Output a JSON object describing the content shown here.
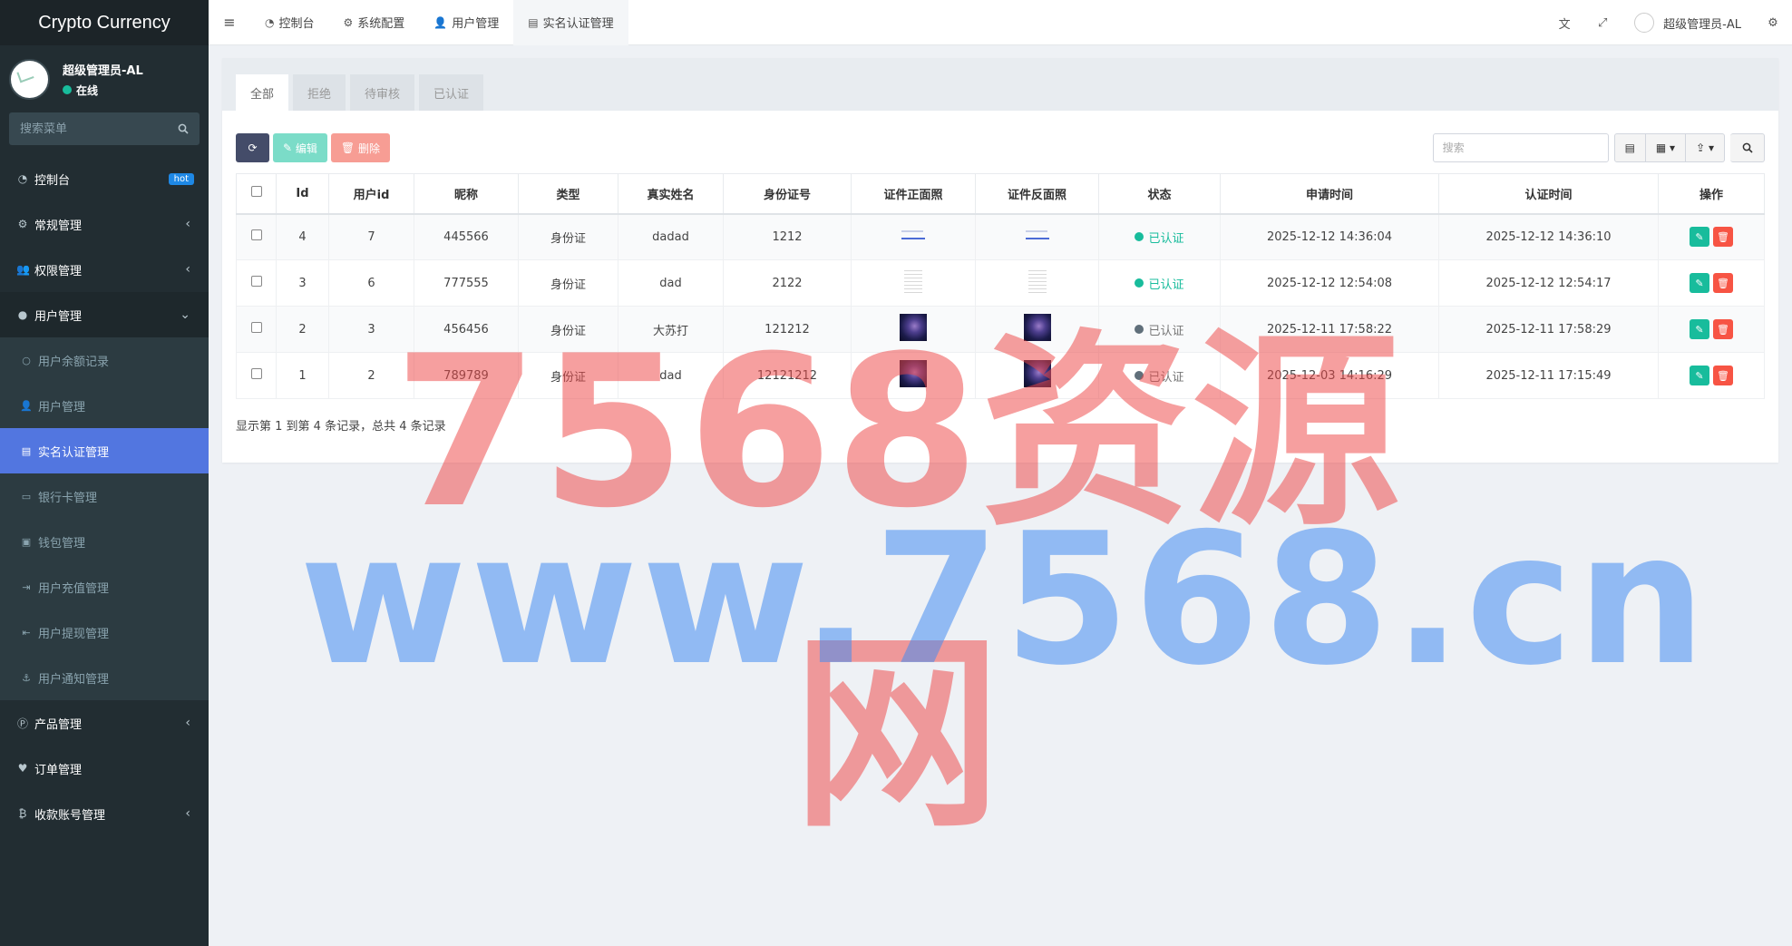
{
  "app": {
    "title": "Crypto Currency"
  },
  "user": {
    "name": "超级管理员-AL",
    "status": "在线"
  },
  "sidebar": {
    "search_placeholder": "搜索菜单",
    "items": [
      {
        "label": "控制台",
        "icon": "dashboard-icon",
        "badge": "hot"
      },
      {
        "label": "常规管理",
        "icon": "cogs-icon"
      },
      {
        "label": "权限管理",
        "icon": "group-icon"
      },
      {
        "label": "用户管理",
        "icon": "user-circle-icon"
      }
    ],
    "sub_items": [
      {
        "label": "用户余额记录",
        "icon": "circle-icon"
      },
      {
        "label": "用户管理",
        "icon": "user-icon"
      },
      {
        "label": "实名认证管理",
        "icon": "id-card-icon"
      },
      {
        "label": "银行卡管理",
        "icon": "credit-card-icon"
      },
      {
        "label": "钱包管理",
        "icon": "money-icon"
      },
      {
        "label": "用户充值管理",
        "icon": "sign-in-icon"
      },
      {
        "label": "用户提现管理",
        "icon": "sign-out-icon"
      },
      {
        "label": "用户通知管理",
        "icon": "anchor-icon"
      }
    ],
    "bottom_items": [
      {
        "label": "产品管理",
        "icon": "product-icon"
      },
      {
        "label": "订单管理",
        "icon": "heartbeat-icon"
      },
      {
        "label": "收款账号管理",
        "icon": "bitcoin-icon"
      }
    ]
  },
  "navbar": {
    "tabs": [
      {
        "label": "控制台",
        "icon": "dashboard-icon"
      },
      {
        "label": "系统配置",
        "icon": "cog-icon"
      },
      {
        "label": "用户管理",
        "icon": "user-icon"
      },
      {
        "label": "实名认证管理",
        "icon": "id-card-icon"
      }
    ],
    "user_name": "超级管理员-AL"
  },
  "panel": {
    "tabs": [
      "全部",
      "拒绝",
      "待审核",
      "已认证"
    ],
    "toolbar": {
      "edit": "编辑",
      "delete": "删除",
      "search_placeholder": "搜索"
    },
    "columns": [
      "Id",
      "用户id",
      "昵称",
      "类型",
      "真实姓名",
      "身份证号",
      "证件正面照",
      "证件反面照",
      "状态",
      "申请时间",
      "认证时间",
      "操作"
    ],
    "rows": [
      {
        "id": "4",
        "uid": "7",
        "nick": "445566",
        "type": "身份证",
        "name": "dadad",
        "idno": "1212",
        "front": "doc",
        "back": "doc",
        "status": "已认证",
        "status_kind": "ok",
        "apply": "2025-12-12 14:36:04",
        "verify": "2025-12-12 14:36:10"
      },
      {
        "id": "3",
        "uid": "6",
        "nick": "777555",
        "type": "身份证",
        "name": "dad",
        "idno": "2122",
        "front": "text",
        "back": "text",
        "status": "已认证",
        "status_kind": "ok",
        "apply": "2025-12-12 12:54:08",
        "verify": "2025-12-12 12:54:17"
      },
      {
        "id": "2",
        "uid": "3",
        "nick": "456456",
        "type": "身份证",
        "name": "大苏打",
        "idno": "121212",
        "front": "photo",
        "back": "photo",
        "status": "已认证",
        "status_kind": "no",
        "apply": "2025-12-11 17:58:22",
        "verify": "2025-12-11 17:58:29"
      },
      {
        "id": "1",
        "uid": "2",
        "nick": "789789",
        "type": "身份证",
        "name": "dad",
        "idno": "12121212",
        "front": "photo",
        "back": "photo",
        "status": "已认证",
        "status_kind": "no",
        "apply": "2025-12-03 14:16:29",
        "verify": "2025-12-11 17:15:49"
      }
    ],
    "pager_info": "显示第 1 到第 4 条记录，总共 4 条记录"
  },
  "watermark": {
    "line1": "7568资源网",
    "line2": "www.7568.cn"
  },
  "colors": {
    "sidebar_bg": "#222d32",
    "active_item": "#5276e0",
    "success": "#18bc9c",
    "danger": "#f75444"
  }
}
